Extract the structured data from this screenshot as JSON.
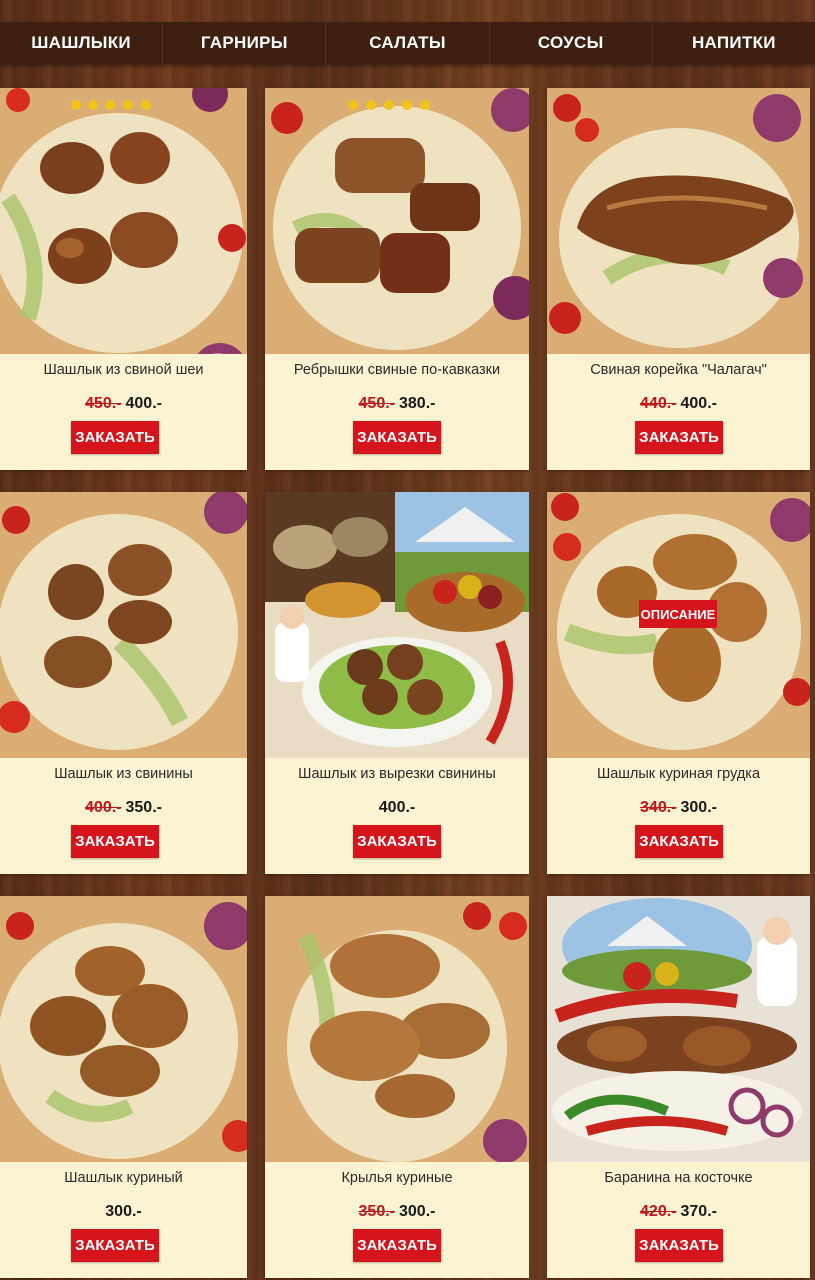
{
  "nav": [
    "ШАШЛЫКИ",
    "ГАРНИРЫ",
    "САЛАТЫ",
    "СОУСЫ",
    "НАПИТКИ"
  ],
  "products": [
    {
      "name": "Шашлык из свиной шеи",
      "old_price": "450.-",
      "price": "400.-",
      "button": "ЗАКАЗАТЬ"
    },
    {
      "name": "Ребрышки свиные по-кавказки",
      "old_price": "450.-",
      "price": "380.-",
      "button": "ЗАКАЗАТЬ"
    },
    {
      "name": "Свиная корейка \"Чалагач\"",
      "old_price": "440.-",
      "price": "400.-",
      "button": "ЗАКАЗАТЬ"
    },
    {
      "name": "Шашлык из свинины",
      "old_price": "400.-",
      "price": "350.-",
      "button": "ЗАКАЗАТЬ"
    },
    {
      "name": "Шашлык из вырезки свинины",
      "old_price": "",
      "price": "400.-",
      "button": "ЗАКАЗАТЬ"
    },
    {
      "name": "Шашлык куриная грудка",
      "old_price": "340.-",
      "price": "300.-",
      "button": "ЗАКАЗАТЬ",
      "overlay": "ОПИСАНИЕ"
    },
    {
      "name": "Шашлык куриный",
      "old_price": "",
      "price": "300.-",
      "button": "ЗАКАЗАТЬ"
    },
    {
      "name": "Крылья куриные",
      "old_price": "350.-",
      "price": "300.-",
      "button": "ЗАКАЗАТЬ"
    },
    {
      "name": "Баранина на косточке",
      "old_price": "420.-",
      "price": "370.-",
      "button": "ЗАКАЗАТЬ"
    }
  ],
  "colors": {
    "accent": "#d6141b",
    "nav_bg": "#3f1f10",
    "card_bg": "#fbf3d2"
  }
}
